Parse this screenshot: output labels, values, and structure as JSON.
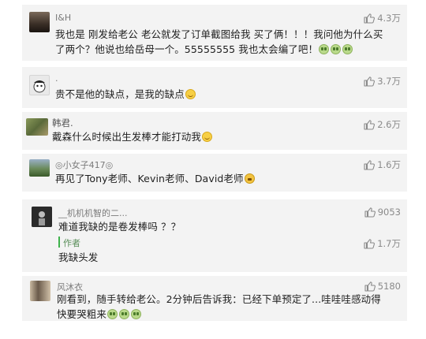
{
  "comments": [
    {
      "username": "I&H",
      "likes": "4.3万",
      "line1": "我也是 刚发给老公 老公就发了订单截图给我 买了俩！！！我问他为什么买",
      "line2": "了两个？他说也给岳母一个。55555555 我也太会编了吧！",
      "emoji": [
        "crying-face",
        "crying-face",
        "crying-face"
      ]
    },
    {
      "username": ".",
      "likes": "3.7万",
      "line1": "贵不是他的缺点，是我的缺点",
      "emoji": [
        "smiling-face"
      ]
    },
    {
      "username": "韩君.",
      "likes": "2.6万",
      "line1": "戴森什么时候出生发棒才能打动我",
      "emoji": [
        "smiling-face"
      ]
    },
    {
      "username": "◎小女子417◎",
      "likes": "1.6万",
      "line1": "再见了Tony老师、Kevin老师、David老师",
      "emoji": [
        "grinning-face"
      ]
    },
    {
      "username": "__机机机智的二...",
      "likes": "9053",
      "line1": "难道我缺的是卷发棒吗 ？？",
      "reply": {
        "author": "作者",
        "text": "我缺头发",
        "likes": "1.7万"
      }
    },
    {
      "username": "风沐衣",
      "likes": "5180",
      "line1": "刚看到，随手转给老公。2分钟后告诉我：已经下单预定了...哇哇哇感动得",
      "line2": "快要哭粗来",
      "emoji": [
        "crying-face",
        "crying-face",
        "crying-face"
      ]
    }
  ],
  "colors": {
    "card_bg": "#f3f3f3",
    "reply_bar": "#3db24a"
  }
}
